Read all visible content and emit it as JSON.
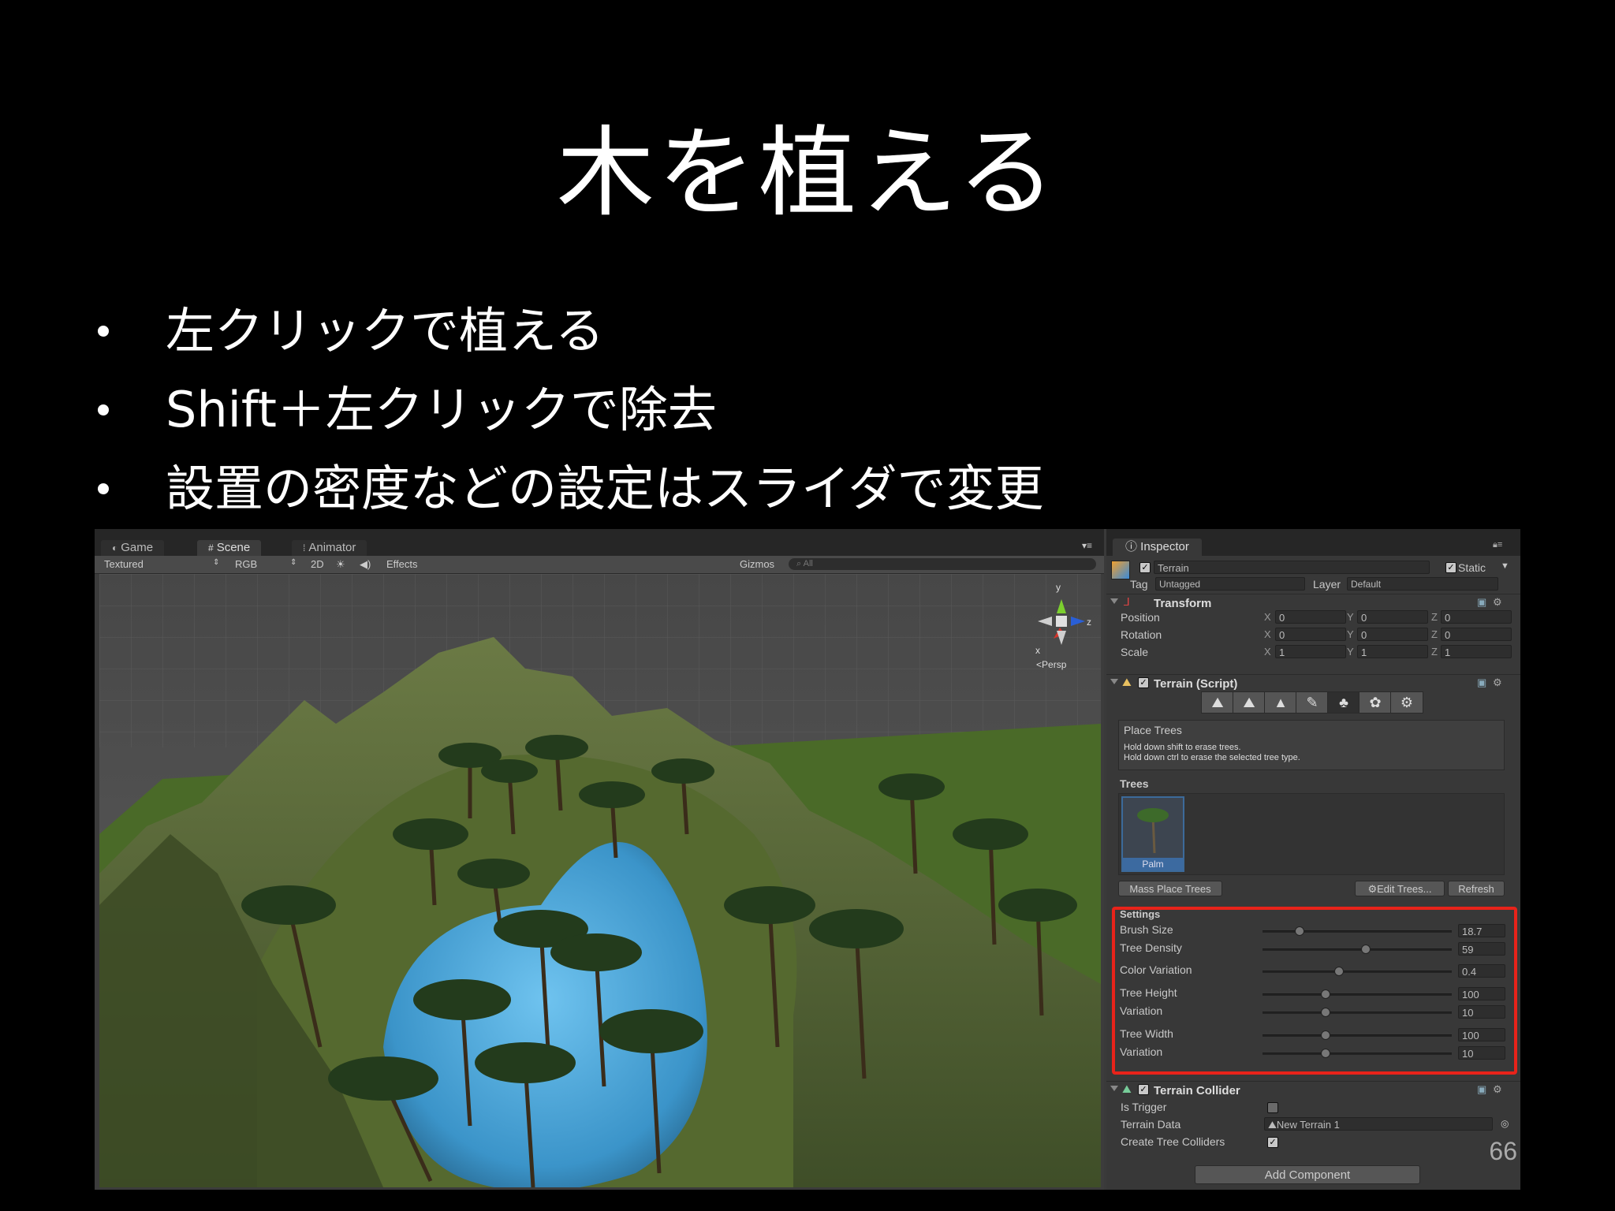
{
  "slide": {
    "title": "木を植える",
    "bullets": [
      "左クリックで植える",
      "Shift＋左クリックで除去",
      "設置の密度などの設定はスライダで変更"
    ],
    "page_number": "66"
  },
  "scene": {
    "tabs": [
      {
        "label": "Game",
        "icon": "game-pad-icon"
      },
      {
        "label": "Scene",
        "icon": "grid-icon"
      },
      {
        "label": "Animator",
        "icon": "animator-icon"
      }
    ],
    "toolbar": {
      "shading": "Textured",
      "render_mode": "RGB",
      "mode_2d": "2D",
      "effects": "Effects",
      "gizmos": "Gizmos",
      "search_placeholder": "All"
    },
    "gizmo": {
      "y": "y",
      "x": "x",
      "z": "z",
      "projection": "Persp"
    }
  },
  "inspector": {
    "tab": "Inspector",
    "object_name": "Terrain",
    "static_label": "Static",
    "tag_label": "Tag",
    "tag_value": "Untagged",
    "layer_label": "Layer",
    "layer_value": "Default",
    "transform": {
      "title": "Transform",
      "rows": [
        {
          "label": "Position",
          "x": "0",
          "y": "0",
          "z": "0"
        },
        {
          "label": "Rotation",
          "x": "0",
          "y": "0",
          "z": "0"
        },
        {
          "label": "Scale",
          "x": "1",
          "y": "1",
          "z": "1"
        }
      ]
    },
    "terrain_script": {
      "title": "Terrain (Script)",
      "tools": [
        "raise-terrain-icon",
        "paint-height-icon",
        "smooth-height-icon",
        "paint-texture-icon",
        "place-trees-icon",
        "paint-details-icon",
        "terrain-settings-icon"
      ],
      "active_tool": 4,
      "help_title": "Place Trees",
      "help_lines": [
        "Hold down shift to erase trees.",
        "Hold down ctrl to erase the selected tree type."
      ],
      "trees_label": "Trees",
      "tree_item": "Palm",
      "mass_place_button": "Mass Place Trees",
      "edit_trees_button": "Edit Trees...",
      "refresh_button": "Refresh",
      "settings_label": "Settings",
      "settings": [
        {
          "label": "Brush Size",
          "value": "18.7",
          "fraction": 0.19
        },
        {
          "label": "Tree Density",
          "value": "59",
          "fraction": 0.54
        },
        {
          "label": "Color Variation",
          "value": "0.4",
          "fraction": 0.4
        },
        {
          "label": "Tree Height",
          "value": "100",
          "fraction": 0.33
        },
        {
          "label": "Variation",
          "value": "10",
          "fraction": 0.33
        },
        {
          "label": "Tree Width",
          "value": "100",
          "fraction": 0.33
        },
        {
          "label": "Variation",
          "value": "10",
          "fraction": 0.33
        }
      ]
    },
    "terrain_collider": {
      "title": "Terrain Collider",
      "is_trigger_label": "Is Trigger",
      "is_trigger": false,
      "terrain_data_label": "Terrain Data",
      "terrain_data_value": "New Terrain 1",
      "create_tree_colliders_label": "Create Tree Colliders",
      "create_tree_colliders": true
    },
    "add_component_button": "Add Component"
  },
  "colors": {
    "highlight": "#e8231a",
    "water": "#4aa3d6",
    "grass": "#4d6a2c",
    "selection": "#3c6aa0"
  }
}
